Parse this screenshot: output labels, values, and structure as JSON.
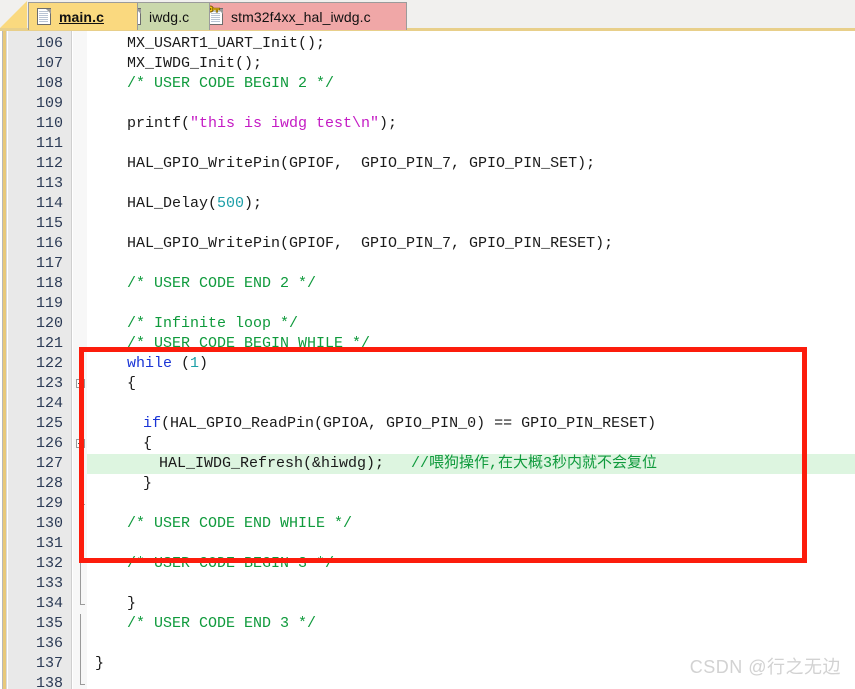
{
  "window": {
    "type": "code-editor",
    "colors": {
      "active_tab": "#fad97f",
      "tab_iwdg": "#cad8ac",
      "tab_hal": "#f0a7a7",
      "gutter": "#e9e9e9",
      "highlight_line": "#ddf5e0",
      "annotation_box": "#fc1c0c",
      "keyword": "#1a35d6",
      "number": "#1d9fa8",
      "string": "#c41ac4",
      "comment": "#0f9a3c"
    }
  },
  "tabs": [
    {
      "label": "main.c",
      "icon": "document-icon",
      "active": true
    },
    {
      "label": "iwdg.c",
      "icon": "document-icon",
      "active": false
    },
    {
      "label": "stm32f4xx_hal_iwdg.c",
      "icon": "document-key-icon",
      "active": false
    }
  ],
  "editor": {
    "first_line": 106,
    "last_line": 138,
    "lines": [
      {
        "n": "106",
        "indent": 2,
        "fold": "none",
        "tokens": [
          {
            "t": "MX_USART1_UART_Init();",
            "c": "plain"
          }
        ]
      },
      {
        "n": "107",
        "indent": 2,
        "fold": "none",
        "tokens": [
          {
            "t": "MX_IWDG_Init();",
            "c": "plain"
          }
        ]
      },
      {
        "n": "108",
        "indent": 2,
        "fold": "none",
        "tokens": [
          {
            "t": "/* USER CODE BEGIN 2 */",
            "c": "cmt"
          }
        ]
      },
      {
        "n": "109",
        "indent": 0,
        "fold": "none",
        "tokens": []
      },
      {
        "n": "110",
        "indent": 2,
        "fold": "none",
        "tokens": [
          {
            "t": "printf(",
            "c": "plain"
          },
          {
            "t": "\"this is iwdg test\\n\"",
            "c": "str"
          },
          {
            "t": ");",
            "c": "plain"
          }
        ]
      },
      {
        "n": "111",
        "indent": 0,
        "fold": "none",
        "tokens": []
      },
      {
        "n": "112",
        "indent": 2,
        "fold": "none",
        "tokens": [
          {
            "t": "HAL_GPIO_WritePin(GPIOF,  GPIO_PIN_7, GPIO_PIN_SET);",
            "c": "plain"
          }
        ]
      },
      {
        "n": "113",
        "indent": 0,
        "fold": "none",
        "tokens": []
      },
      {
        "n": "114",
        "indent": 2,
        "fold": "none",
        "tokens": [
          {
            "t": "HAL_Delay(",
            "c": "plain"
          },
          {
            "t": "500",
            "c": "num"
          },
          {
            "t": ");",
            "c": "plain"
          }
        ]
      },
      {
        "n": "115",
        "indent": 0,
        "fold": "none",
        "tokens": []
      },
      {
        "n": "116",
        "indent": 2,
        "fold": "none",
        "tokens": [
          {
            "t": "HAL_GPIO_WritePin(GPIOF,  GPIO_PIN_7, GPIO_PIN_RESET);",
            "c": "plain"
          }
        ]
      },
      {
        "n": "117",
        "indent": 0,
        "fold": "none",
        "tokens": []
      },
      {
        "n": "118",
        "indent": 2,
        "fold": "none",
        "tokens": [
          {
            "t": "/* USER CODE END 2 */",
            "c": "cmt"
          }
        ]
      },
      {
        "n": "119",
        "indent": 0,
        "fold": "none",
        "tokens": []
      },
      {
        "n": "120",
        "indent": 2,
        "fold": "none",
        "tokens": [
          {
            "t": "/* Infinite loop */",
            "c": "cmt"
          }
        ]
      },
      {
        "n": "121",
        "indent": 2,
        "fold": "none",
        "tokens": [
          {
            "t": "/* USER CODE BEGIN WHILE */",
            "c": "cmt"
          }
        ]
      },
      {
        "n": "122",
        "indent": 2,
        "fold": "none",
        "tokens": [
          {
            "t": "while",
            "c": "kw"
          },
          {
            "t": " (",
            "c": "plain"
          },
          {
            "t": "1",
            "c": "num"
          },
          {
            "t": ")",
            "c": "plain"
          }
        ]
      },
      {
        "n": "123",
        "indent": 2,
        "fold": "minus",
        "tokens": [
          {
            "t": "{",
            "c": "plain"
          }
        ]
      },
      {
        "n": "124",
        "indent": 0,
        "fold": "line",
        "tokens": []
      },
      {
        "n": "125",
        "indent": 3,
        "fold": "line",
        "tokens": [
          {
            "t": "if",
            "c": "kw"
          },
          {
            "t": "(HAL_GPIO_ReadPin(GPIOA, GPIO_PIN_0) == GPIO_PIN_RESET)",
            "c": "plain"
          }
        ]
      },
      {
        "n": "126",
        "indent": 3,
        "fold": "minus",
        "tokens": [
          {
            "t": "{",
            "c": "plain"
          }
        ]
      },
      {
        "n": "127",
        "indent": 4,
        "fold": "line",
        "highlight": true,
        "tokens": [
          {
            "t": "HAL_IWDG_Refresh(&hiwdg);   ",
            "c": "plain"
          },
          {
            "t": "//喂狗操作,在大概3秒内就不会复位",
            "c": "cmt"
          }
        ]
      },
      {
        "n": "128",
        "indent": 3,
        "fold": "line",
        "tokens": [
          {
            "t": "}",
            "c": "plain"
          }
        ]
      },
      {
        "n": "129",
        "indent": 0,
        "fold": "end",
        "tokens": []
      },
      {
        "n": "130",
        "indent": 2,
        "fold": "line",
        "tokens": [
          {
            "t": "/* USER CODE END WHILE */",
            "c": "cmt"
          }
        ]
      },
      {
        "n": "131",
        "indent": 0,
        "fold": "line",
        "tokens": []
      },
      {
        "n": "132",
        "indent": 2,
        "fold": "line",
        "tokens": [
          {
            "t": "/* USER CODE BEGIN 3 */",
            "c": "cmt"
          }
        ]
      },
      {
        "n": "133",
        "indent": 0,
        "fold": "line",
        "tokens": []
      },
      {
        "n": "134",
        "indent": 2,
        "fold": "end",
        "tokens": [
          {
            "t": "}",
            "c": "plain"
          }
        ]
      },
      {
        "n": "135",
        "indent": 2,
        "fold": "line",
        "tokens": [
          {
            "t": "/* USER CODE END 3 */",
            "c": "cmt"
          }
        ]
      },
      {
        "n": "136",
        "indent": 0,
        "fold": "line",
        "tokens": []
      },
      {
        "n": "137",
        "indent": 0,
        "fold": "line",
        "tokens": [
          {
            "t": "}",
            "c": "plain"
          }
        ]
      },
      {
        "n": "138",
        "indent": 0,
        "fold": "end",
        "tokens": []
      }
    ]
  },
  "annotation": {
    "type": "red-rectangle",
    "encloses_lines": "121-132"
  },
  "watermark": {
    "text": "CSDN @行之无边"
  }
}
